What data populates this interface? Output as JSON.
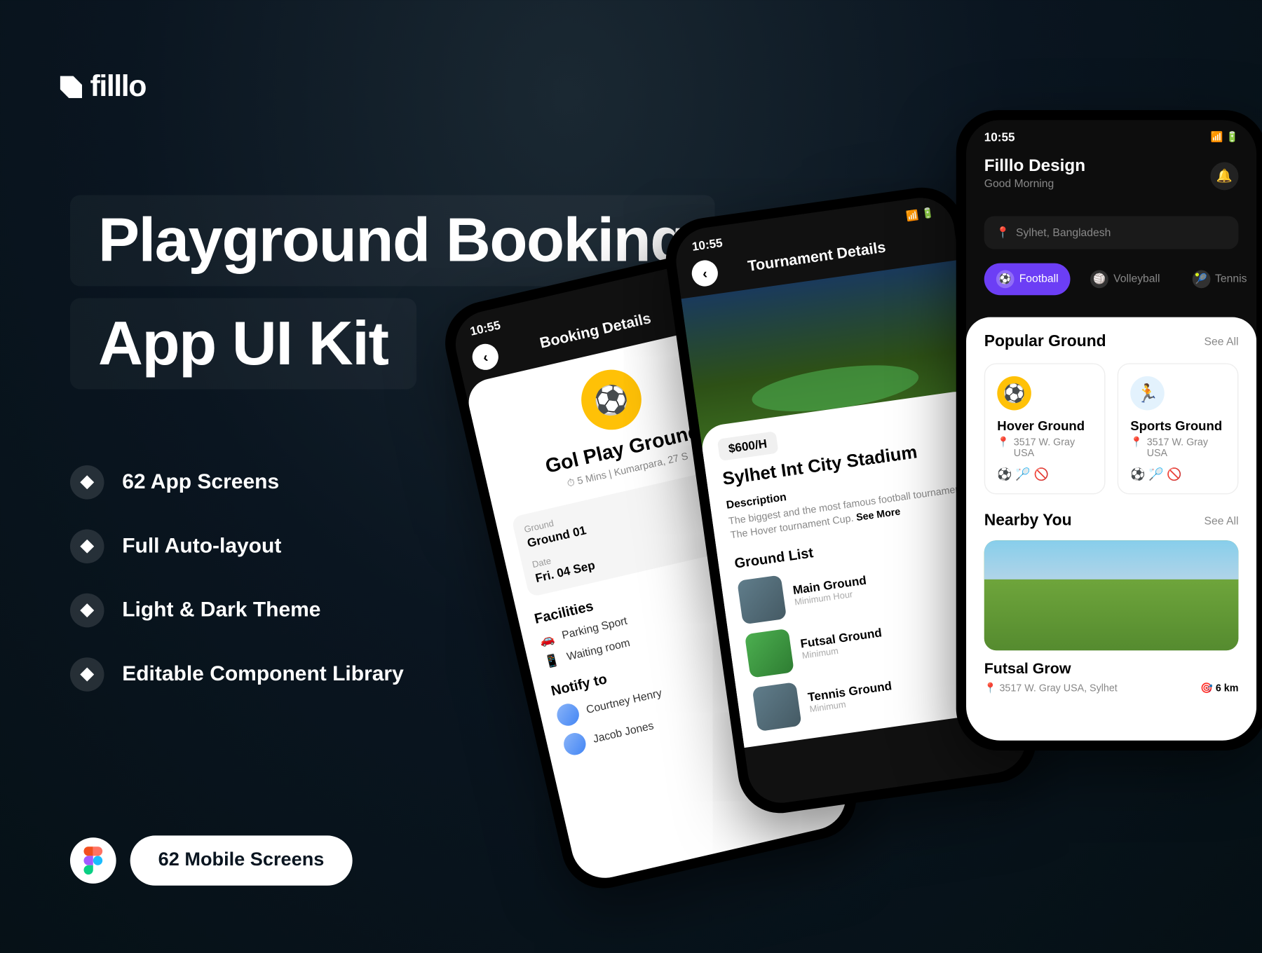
{
  "brand": "filllo",
  "headline": {
    "l1": "Playground Booking",
    "l2": "App UI Kit"
  },
  "features": [
    "62 App Screens",
    "Full Auto-layout",
    "Light & Dark Theme",
    "Editable Component Library"
  ],
  "cta": "62 Mobile Screens",
  "time": "10:55",
  "p1": {
    "header": "Booking Details",
    "title": "Gol Play Ground",
    "sub": "5 Mins | Kumarpara, 27 S",
    "ground_lbl": "Ground",
    "ground_val": "Ground 01",
    "date_lbl": "Date",
    "date_val": "Fri. 04 Sep",
    "facilities": "Facilities",
    "fac1": "Parking Sport",
    "fac2": "Waiting room",
    "notify": "Notify to",
    "n1": "Courtney Henry",
    "n2": "Jacob Jones"
  },
  "p2": {
    "header": "Tournament Details",
    "price": "$600/H",
    "title": "Sylhet Int City Stadium",
    "desc_lbl": "Description",
    "desc": "The biggest and the most famous football tournament is The Hover tournament Cup.",
    "more": "See More",
    "list": "Ground List",
    "g1": "Main Ground",
    "g1s": "Minimum Hour",
    "g2": "Futsal Ground",
    "g2s": "Minimum",
    "g3": "Tennis Ground",
    "g3s": "Minimum"
  },
  "p3": {
    "name": "Filllo Design",
    "greet": "Good Morning",
    "location": "Sylhet, Bangladesh",
    "cats": [
      "Football",
      "Volleyball",
      "Tennis"
    ],
    "popular": "Popular Ground",
    "see": "See All",
    "c1": "Hover Ground",
    "c2": "Sports Ground",
    "addr": "3517 W. Gray USA",
    "nearby": "Nearby You",
    "ntitle": "Futsal Grow",
    "naddr": "3517 W. Gray USA, Sylhet",
    "dist": "6 km"
  }
}
